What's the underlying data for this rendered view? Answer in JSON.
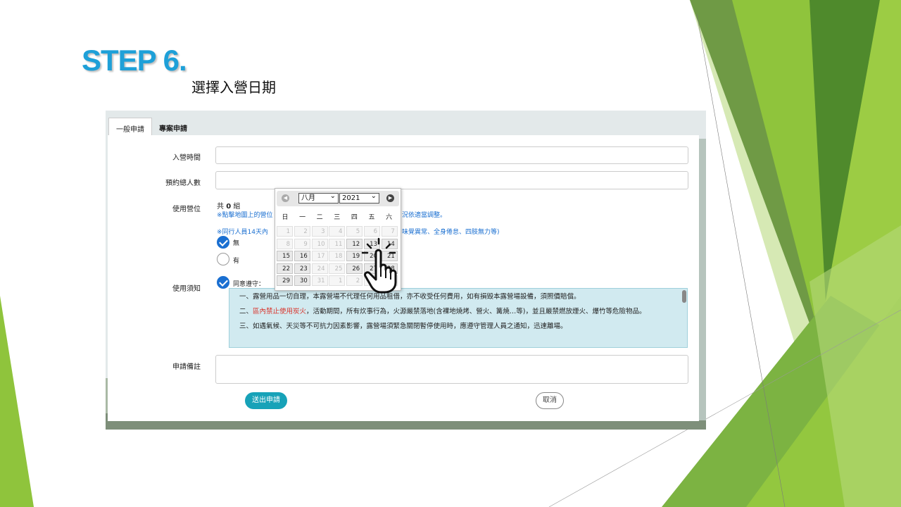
{
  "slide": {
    "title": "STEP 6.",
    "subtitle": "選擇入營日期"
  },
  "tabs": [
    {
      "label": "一般申請",
      "active": true
    },
    {
      "label": "專案申請",
      "active": false
    }
  ],
  "form": {
    "camp_time_label": "入營時間",
    "people_label": "預約總人數",
    "site_label": "使用營位",
    "site_count_prefix": "共",
    "site_count": "0",
    "site_count_suffix": "組",
    "site_note_a": "※點擊地圖上的營位",
    "site_note_b": "況依適當調整。",
    "companion_note_a": "※同行人員14天內",
    "companion_note_b": "味覺異常、全身倦怠、四肢無力等)",
    "option_none": "無",
    "option_yes": "有",
    "rules_label": "使用須知",
    "agree_label": "同意遵守：",
    "rule1": "一、露營用品一切自理，本露營場不代理任何用品租借，亦不收受任何費用，如有損毀本露營場設備，須照價賠償。",
    "rule2_prefix": "二、",
    "rule2_red": "區內禁止使用炭火",
    "rule2_rest": "，活動期間，所有炊事行為，火源嚴禁落地(含裸地燒烤、營火、篝燒…等)，並且嚴禁燃放煙火、爆竹等危險物品。",
    "rule3": "三、如遇氣候、天災等不可抗力因素影響，露營場須緊急關閉暫停使用時，應遵守管理人員之通知，迅速離場。",
    "remark_label": "申請備註",
    "submit_label": "送出申請",
    "cancel_label": "取消"
  },
  "calendar": {
    "month": "八月",
    "year": "2021",
    "weekdays": [
      "日",
      "一",
      "二",
      "三",
      "四",
      "五",
      "六"
    ],
    "rows": [
      [
        "1",
        "2",
        "3",
        "4",
        "5",
        "6",
        "7"
      ],
      [
        "8",
        "9",
        "10",
        "11",
        "12",
        "13",
        "14"
      ],
      [
        "15",
        "16",
        "17",
        "18",
        "19",
        "20",
        "21"
      ],
      [
        "22",
        "23",
        "24",
        "25",
        "26",
        "27",
        "28"
      ],
      [
        "29",
        "30",
        "31",
        "1",
        "2",
        "3",
        "4"
      ]
    ],
    "enabled": [
      "12",
      "13",
      "14",
      "15",
      "16",
      "19",
      "20",
      "21",
      "22",
      "23",
      "26",
      "27",
      "28",
      "29",
      "30"
    ]
  },
  "colors": {
    "step_blue": "#1ea0d8",
    "submit_teal": "#17a2b8",
    "notice_bg": "#d1eaf0",
    "accent_green": "#8dc63f"
  },
  "icons": [
    "calendar-prev-icon",
    "calendar-next-icon",
    "pointing-hand-icon",
    "checkmark-icon"
  ]
}
